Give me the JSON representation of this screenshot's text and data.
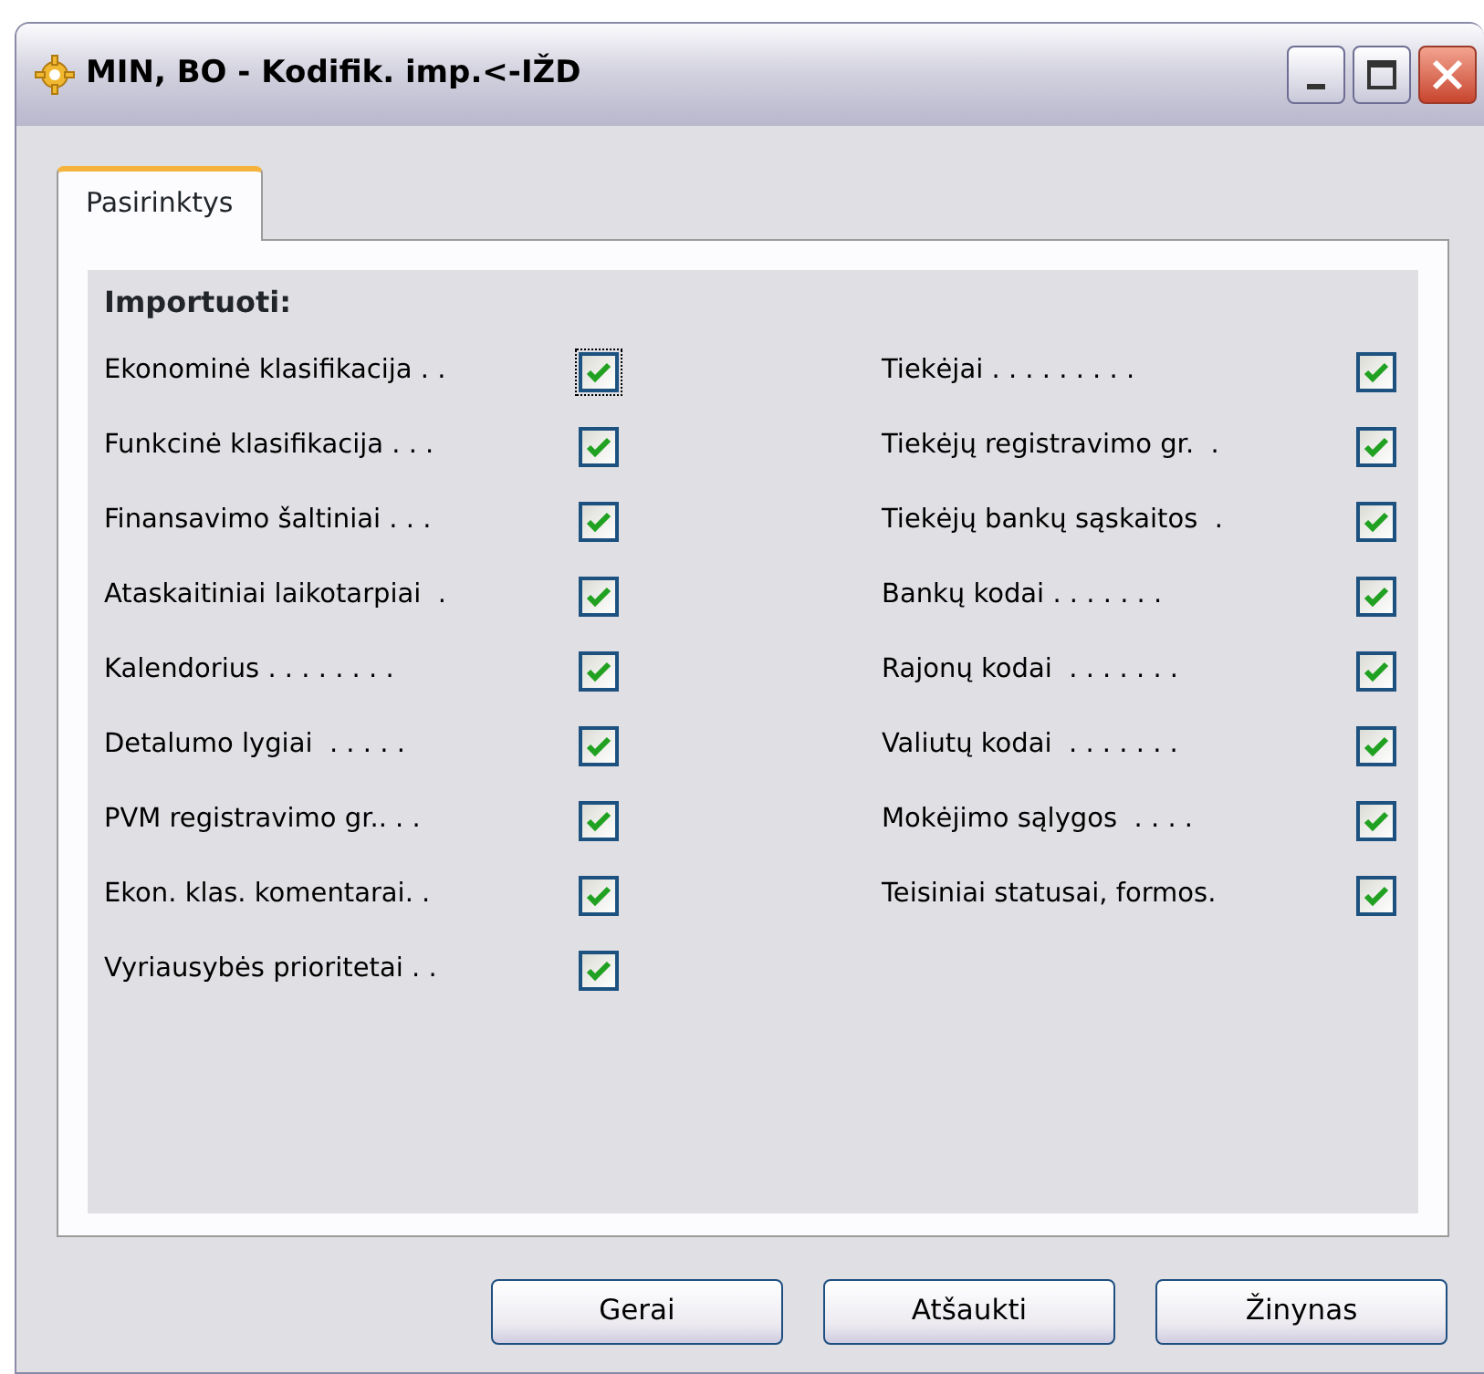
{
  "window": {
    "title": "MIN, BO - Kodifik. imp.<-IŽD"
  },
  "tabs": [
    {
      "label": "Pasirinktys",
      "selected": true
    }
  ],
  "group": {
    "heading": "Importuoti:"
  },
  "columns": [
    [
      {
        "label": "Ekonominė klasifikacija . .",
        "checked": true,
        "focused": true
      },
      {
        "label": "Funkcinė klasifikacija . . .",
        "checked": true,
        "focused": false
      },
      {
        "label": "Finansavimo šaltiniai . . .",
        "checked": true,
        "focused": false
      },
      {
        "label": "Ataskaitiniai laikotarpiai  .",
        "checked": true,
        "focused": false
      },
      {
        "label": "Kalendorius . . . . . . . .",
        "checked": true,
        "focused": false
      },
      {
        "label": "Detalumo lygiai  . . . . .",
        "checked": true,
        "focused": false
      },
      {
        "label": "PVM registravimo gr.. . .",
        "checked": true,
        "focused": false
      },
      {
        "label": "Ekon. klas. komentarai. .",
        "checked": true,
        "focused": false
      },
      {
        "label": "Vyriausybės prioritetai . .",
        "checked": true,
        "focused": false
      }
    ],
    [
      {
        "label": "Tiekėjai . . . . . . . . .",
        "checked": true,
        "focused": false
      },
      {
        "label": "Tiekėjų registravimo gr.  .",
        "checked": true,
        "focused": false
      },
      {
        "label": "Tiekėjų bankų sąskaitos  .",
        "checked": true,
        "focused": false
      },
      {
        "label": "Bankų kodai . . . . . . .",
        "checked": true,
        "focused": false
      },
      {
        "label": "Rajonų kodai  . . . . . . .",
        "checked": true,
        "focused": false
      },
      {
        "label": "Valiutų kodai  . . . . . . .",
        "checked": true,
        "focused": false
      },
      {
        "label": "Mokėjimo sąlygos  . . . .",
        "checked": true,
        "focused": false
      },
      {
        "label": "Teisiniai statusai, formos.",
        "checked": true,
        "focused": false
      }
    ]
  ],
  "buttons": [
    "Gerai",
    "Atšaukti",
    "Žinynas"
  ]
}
